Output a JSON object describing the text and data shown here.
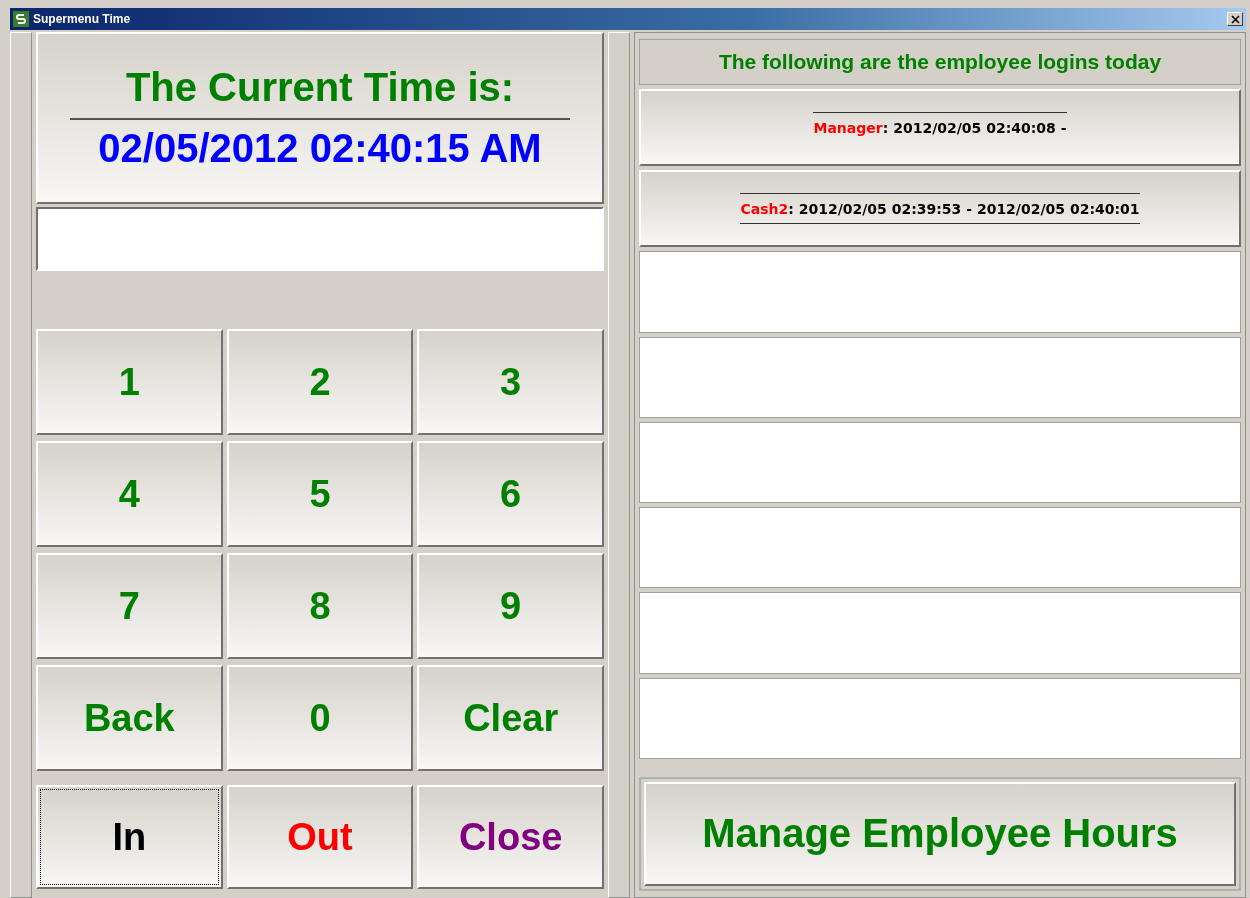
{
  "window": {
    "title": "Supermenu Time"
  },
  "clock": {
    "label": "The Current Time is:",
    "time": "02/05/2012 02:40:15 AM"
  },
  "keypad": [
    "1",
    "2",
    "3",
    "4",
    "5",
    "6",
    "7",
    "8",
    "9",
    "Back",
    "0",
    "Clear"
  ],
  "actions": [
    {
      "label": "In",
      "color": "#000000",
      "focused": true
    },
    {
      "label": "Out",
      "color": "#ff0000",
      "focused": false
    },
    {
      "label": "Close",
      "color": "#800080",
      "focused": false
    }
  ],
  "logins": {
    "heading": "The following are the employee logins today",
    "items": [
      {
        "name": "Manager",
        "times": ": 2012/02/05 02:40:08 -",
        "rule_below": false
      },
      {
        "name": "Cash2",
        "times": ": 2012/02/05 02:39:53 - 2012/02/05 02:40:01",
        "rule_below": true
      }
    ]
  },
  "manage_button": "Manage Employee Hours"
}
